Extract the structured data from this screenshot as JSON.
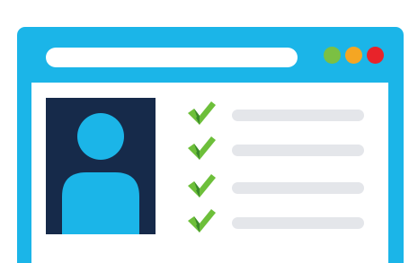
{
  "colors": {
    "frame": "#1bb5e8",
    "address_bar": "#ffffff",
    "dot_green": "#7bc043",
    "dot_yellow": "#f5a623",
    "dot_red": "#e8232a",
    "avatar_background": "#162a4a",
    "avatar_figure": "#1bb5e8",
    "check_light": "#6dbf3a",
    "check_dark": "#3a8a2a",
    "placeholder_line": "#e4e6ea"
  },
  "window_controls": [
    {
      "name": "green",
      "color": "#7bc043"
    },
    {
      "name": "yellow",
      "color": "#f5a623"
    },
    {
      "name": "red",
      "color": "#e8232a"
    }
  ],
  "checklist": [
    {
      "icon": "checkmark-icon"
    },
    {
      "icon": "checkmark-icon"
    },
    {
      "icon": "checkmark-icon"
    },
    {
      "icon": "checkmark-icon"
    }
  ]
}
